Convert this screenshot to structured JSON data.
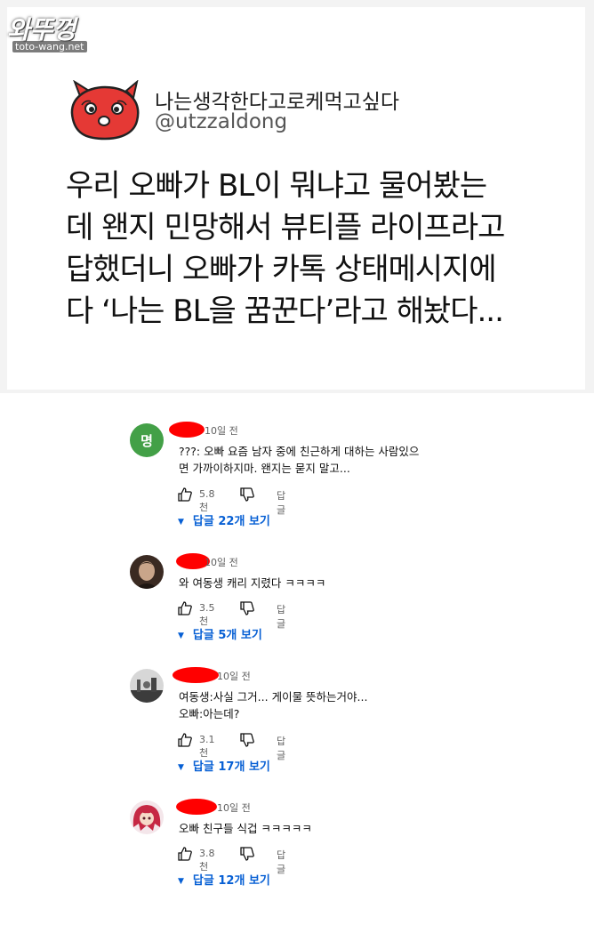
{
  "watermark": {
    "logo": "와뚜껑",
    "url": "toto-wang.net"
  },
  "tweet": {
    "name": "나는생각한다고로케먹고싶다",
    "handle": "@utzzaldong",
    "lines": [
      "우리 오빠가 BL이 뭐냐고 물어봤는",
      "데 왠지 민망해서 뷰티플 라이프라고",
      "답했더니 오빠가 카톡 상태메시지에",
      "다 ‘나는 BL을 꿈꾼다’라고 해놨다..."
    ]
  },
  "comments": [
    {
      "avatar_letter": "명",
      "time": "10일 전",
      "lines": [
        "???: 오빠 요즘 남자 중에 친근하게 대하는 사람있으",
        "면 가까이하지마. 왠지는 묻지 말고..."
      ],
      "likes": "5.8천",
      "reply_label": "답글",
      "replies_label": "답글 22개 보기"
    },
    {
      "avatar_letter": "",
      "time": "10일 전",
      "lines": [
        "와 여동생 캐리 지렸다 ㅋㅋㅋㅋ"
      ],
      "likes": "3.5천",
      "reply_label": "답글",
      "replies_label": "답글 5개 보기"
    },
    {
      "avatar_letter": "",
      "time": "10일 전",
      "lines": [
        "여동생:사실 그거... 게이물 뜻하는거야...",
        "오빠:아는데?"
      ],
      "likes": "3.1천",
      "reply_label": "답글",
      "replies_label": "답글 17개 보기"
    },
    {
      "avatar_letter": "",
      "time": "10일 전",
      "lines": [
        "오빠 친구들 식겁 ㅋㅋㅋㅋㅋ"
      ],
      "likes": "3.8천",
      "reply_label": "답글",
      "replies_label": "답글 12개 보기"
    }
  ],
  "icons": {
    "like": "thumbs-up-icon",
    "dislike": "thumbs-down-icon",
    "expand": "chevron-down-icon"
  },
  "colors": {
    "link": "#065fd4",
    "redaction": "#ff0000",
    "avatar_green": "#43a047",
    "mascot_red": "#e53935"
  }
}
